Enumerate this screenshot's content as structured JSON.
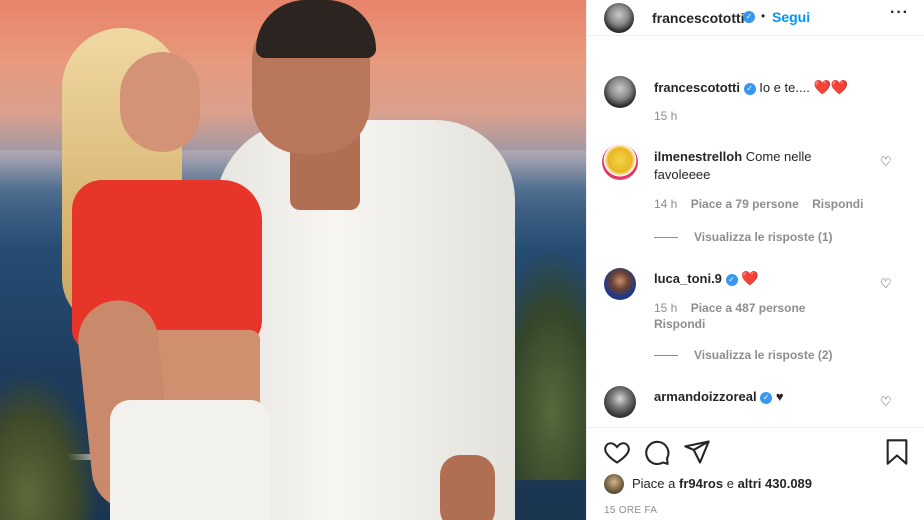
{
  "post": {
    "author": "francescototti",
    "follow_label": "Segui",
    "more_icon": "more-horizontal-icon"
  },
  "caption": {
    "username": "francescototti",
    "text": "Io e te....",
    "time": "15 h"
  },
  "comments": [
    {
      "username": "ilmenestrelloh",
      "text": "Come nelle favoleeee",
      "time": "14 h",
      "likes": "Piace a 79 persone",
      "reply": "Rispondi",
      "view_replies": "Visualizza le risposte (1)"
    },
    {
      "username": "luca_toni.9",
      "text": "",
      "time": "15 h",
      "likes": "Piace a 487 persone",
      "reply": "Rispondi",
      "view_replies": "Visualizza le risposte (2)"
    },
    {
      "username": "armandoizzoreal",
      "text": "♥"
    }
  ],
  "footer": {
    "likes_prefix": "Piace a",
    "likes_user": "fr94ros",
    "likes_middle": "e",
    "likes_others": "altri 430.089",
    "timestamp": "15 ORE FA"
  },
  "colors": {
    "accent": "#0095f6",
    "verified": "#3897f0",
    "heart": "#ed4956"
  }
}
